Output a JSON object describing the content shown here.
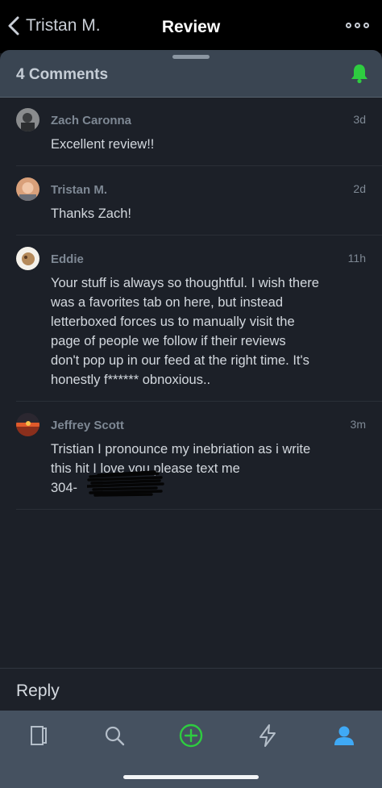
{
  "nav": {
    "back_label": "Tristan M.",
    "title": "Review"
  },
  "sheet": {
    "count_label": "4 Comments"
  },
  "comments": [
    {
      "name": "Zach Caronna",
      "time": "3d",
      "text": "Excellent review!!"
    },
    {
      "name": "Tristan M.",
      "time": "2d",
      "text": "Thanks Zach!"
    },
    {
      "name": "Eddie",
      "time": "11h",
      "text": "Your stuff is always so thoughtful. I wish there\nwas a favorites tab on here, but instead\nletterboxed forces us to manually visit the\npage of people we follow if their reviews\ndon't pop up in our feed at the right time. It's\nhonestly f****** obnoxious.."
    },
    {
      "name": "Jeffrey Scott",
      "time": "3m",
      "text": "Tristian I pronounce my inebriation as i write\nthis hit I love you please text me\n304-"
    }
  ],
  "reply": {
    "placeholder": "Reply"
  },
  "colors": {
    "accent": "#2ecc40",
    "active_tab": "#3fa9f5"
  },
  "tabs": [
    "journal-icon",
    "search-icon",
    "add-icon",
    "activity-icon",
    "profile-icon"
  ]
}
